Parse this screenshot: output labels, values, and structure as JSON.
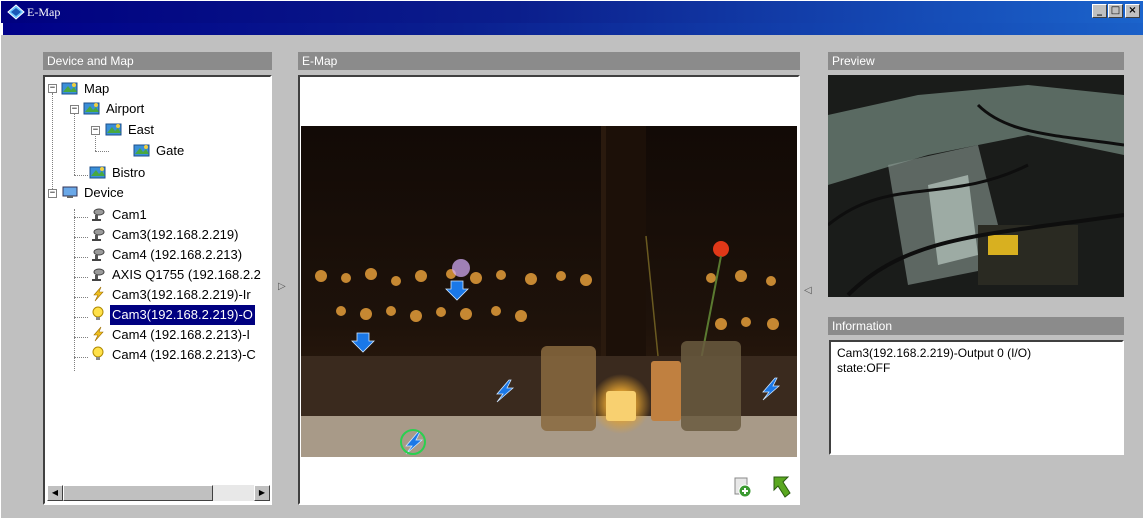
{
  "window": {
    "title": "E-Map",
    "minimize_label": "_",
    "maximize_label": "□",
    "close_label": "×",
    "titlebar_color": "#000080"
  },
  "panes": {
    "device_map_header": "Device and Map",
    "emap_header": "E-Map",
    "preview_header": "Preview",
    "information_header": "Information"
  },
  "tree": {
    "items": [
      {
        "label": "Map",
        "icon": "map-icon"
      },
      {
        "label": "Airport",
        "icon": "map-icon"
      },
      {
        "label": "East",
        "icon": "map-icon"
      },
      {
        "label": "Gate",
        "icon": "map-icon"
      },
      {
        "label": "Bistro",
        "icon": "map-icon"
      },
      {
        "label": "Device",
        "icon": "monitor-icon"
      },
      {
        "label": "Cam1",
        "icon": "camera-icon"
      },
      {
        "label": "Cam3(192.168.2.219)",
        "icon": "camera-icon"
      },
      {
        "label": "Cam4 (192.168.2.213)",
        "icon": "camera-icon"
      },
      {
        "label": "AXIS Q1755 (192.168.2.2",
        "icon": "camera-icon"
      },
      {
        "label": "Cam3(192.168.2.219)-Ir",
        "icon": "lightning-icon"
      },
      {
        "label": "Cam3(192.168.2.219)-O",
        "icon": "lightbulb-icon",
        "selected": true
      },
      {
        "label": "Cam4 (192.168.2.213)-I",
        "icon": "lightning-icon"
      },
      {
        "label": "Cam4 (192.168.2.213)-C",
        "icon": "lightbulb-icon"
      }
    ]
  },
  "information": {
    "line1": "Cam3(192.168.2.219)-Output 0 (I/O)",
    "line2": "state:OFF"
  },
  "toolbar_icons": [
    "add-device-icon",
    "back-arrow-icon"
  ],
  "splitters": {
    "left": "▷",
    "right": "◁"
  },
  "scroll": {
    "left": "◀",
    "right": "▶"
  }
}
